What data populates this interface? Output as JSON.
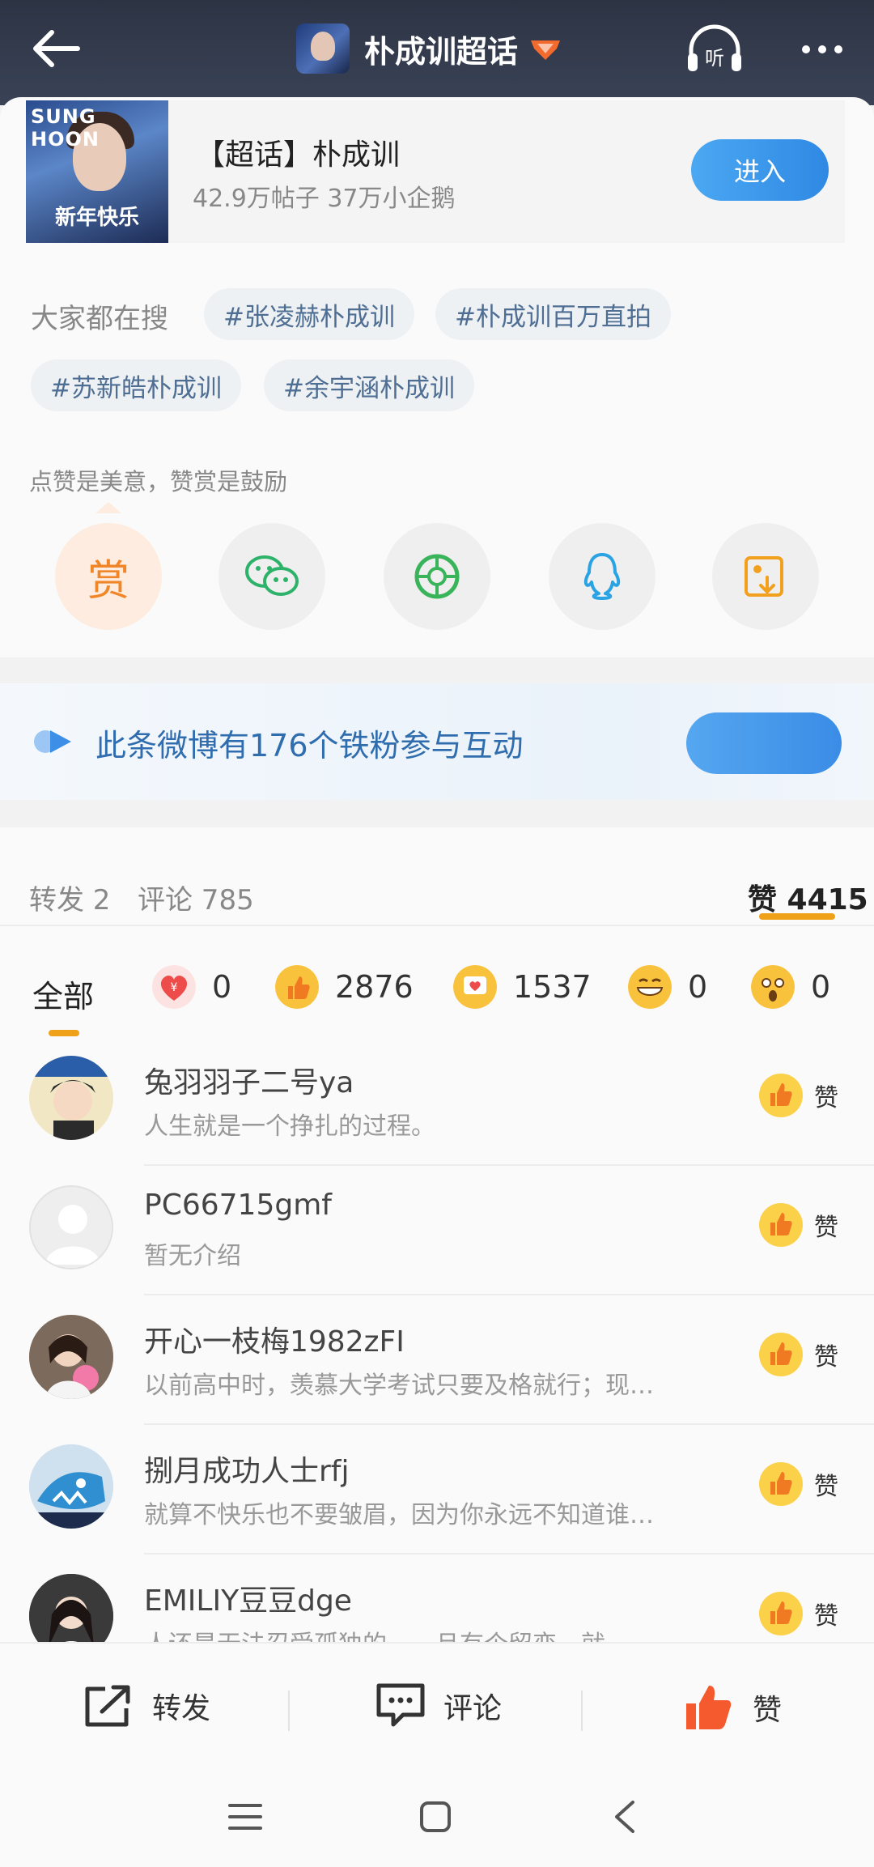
{
  "header": {
    "title": "朴成训超话",
    "back_icon": "back-arrow-icon",
    "listen_label": "听",
    "more_icon": "more-dots-icon",
    "bg_color": "#2f3749"
  },
  "super_topic": {
    "cover_logo": "SUNG HOON",
    "cover_caption": "新年快乐",
    "name": "【超话】朴成训",
    "stats": "42.9万帖子 37万小企鹅",
    "enter_label": "进入",
    "accent": "#3b93ea"
  },
  "search": {
    "label": "大家都在搜",
    "tags": [
      "#张凌赫朴成训",
      "#朴成训百万直拍",
      "#苏新皓朴成训",
      "#余宇涵朴成训"
    ]
  },
  "share": {
    "tip": "点赞是美意，赞赏是鼓励",
    "reward_label": "赏",
    "icons": [
      "wechat-icon",
      "moments-icon",
      "qq-icon",
      "save-image-icon"
    ]
  },
  "fans_banner": {
    "text": "此条微博有176个铁粉参与互动"
  },
  "stats_bar": {
    "repost": "转发 2",
    "comment": "评论 785",
    "like": "赞 4415"
  },
  "reactions": {
    "all_label": "全部",
    "items": [
      {
        "icon": "reward-heart-icon",
        "count": "0",
        "color": "#ee4b4b"
      },
      {
        "icon": "thumbs-up-icon",
        "count": "2876",
        "color": "#f8b63a"
      },
      {
        "icon": "heart-bubble-icon",
        "count": "1537",
        "color": "#f8b63a"
      },
      {
        "icon": "laugh-icon",
        "count": "0",
        "color": "#f8c63a"
      },
      {
        "icon": "surprised-icon",
        "count": "0",
        "color": "#f8c63a"
      }
    ]
  },
  "users": [
    {
      "name": "兔羽羽子二号ya",
      "bio": "人生就是一个挣扎的过程。",
      "like_label": "赞"
    },
    {
      "name": "PC66715gmf",
      "bio": "暂无介绍",
      "like_label": "赞"
    },
    {
      "name": "开心一枝梅1982zFI",
      "bio": "以前高中时，羡慕大学考试只要及格就行；现…",
      "like_label": "赞"
    },
    {
      "name": "捌月成功人士rfj",
      "bio": "就算不快乐也不要皱眉，因为你永远不知道谁…",
      "like_label": "赞"
    },
    {
      "name": "EMILIY豆豆dge",
      "bio": "人还是无法忍受孤独的，一旦有个留恋，就…",
      "like_label": "赞"
    }
  ],
  "actions": {
    "repost": "转发",
    "comment": "评论",
    "like": "赞"
  },
  "nav": {
    "menu_icon": "menu-icon",
    "home_icon": "home-square-icon",
    "back_icon": "nav-back-icon"
  }
}
